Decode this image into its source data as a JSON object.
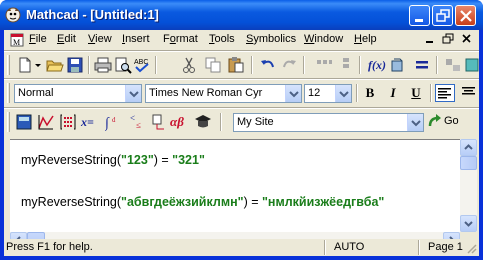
{
  "window": {
    "title": "Mathcad - [Untitled:1]"
  },
  "menu": [
    "File",
    "Edit",
    "View",
    "Insert",
    "Format",
    "Tools",
    "Symbolics",
    "Window",
    "Help"
  ],
  "menu_underline": [
    "F",
    "E",
    "V",
    "I",
    "o",
    "T",
    "S",
    "W",
    "H"
  ],
  "format_bar": {
    "style": "Normal",
    "font": "Times New Roman Cyr",
    "size": "12"
  },
  "format_buttons": {
    "bold": "B",
    "italic": "I",
    "underline": "U"
  },
  "resource_bar": {
    "site": "My Site",
    "go_label": "Go"
  },
  "math_toolbar": {
    "xeq": "x=",
    "alpha_beta": "αβ"
  },
  "worksheet": {
    "expr1": {
      "fn": "myReverseString(",
      "arg": "\"123\"",
      "close": ") = ",
      "result": "\"321\""
    },
    "expr2": {
      "fn": "myReverseString(",
      "arg": "\"абвгдеёжзийклмн\"",
      "close": ") = ",
      "result": "\"нмлкйизжёедгвба\""
    }
  },
  "status": {
    "help": "Press F1 for help.",
    "mode": "AUTO",
    "page": "Page 1"
  },
  "colors": {
    "title_blue": "#0a5ae0",
    "string_green": "#1a7d1a",
    "face": "#ece9d8"
  }
}
